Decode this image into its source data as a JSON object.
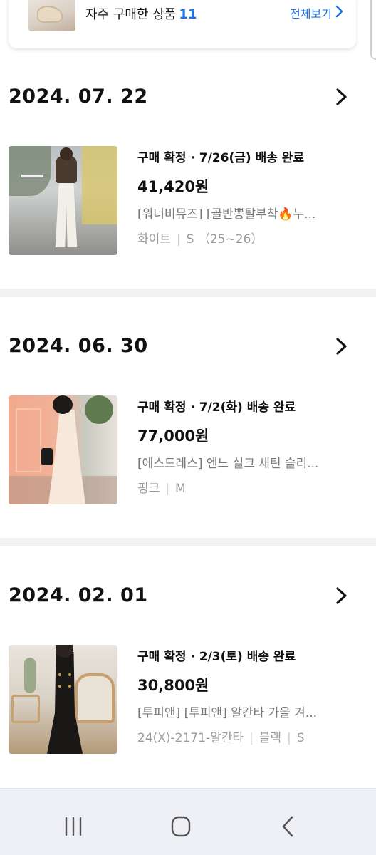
{
  "frequent": {
    "label": "자주 구매한 상품",
    "count": "11",
    "view_all": "전체보기"
  },
  "orders": [
    {
      "date": "2024. 07. 22",
      "status": "구매 확정 · 7/26(금) 배송 완료",
      "price": "41,420원",
      "name": "[워너비뮤즈] [골반뽕탈부착🔥누...",
      "options": [
        "화이트",
        "S （25~26）"
      ]
    },
    {
      "date": "2024. 06. 30",
      "status": "구매 확정 · 7/2(화) 배송 완료",
      "price": "77,000원",
      "name": "[에스드레스] 엔느 실크 새틴 슬리...",
      "options": [
        "핑크",
        "M"
      ]
    },
    {
      "date": "2024. 02. 01",
      "status": "구매 확정 · 2/3(토) 배송 완료",
      "price": "30,800원",
      "name": "[투피앤] [투피앤] 알칸타 가을 겨...",
      "options": [
        "24(X)-2171-알칸타",
        "블랙",
        "S"
      ]
    }
  ],
  "nav": {
    "icons": [
      "recent-apps-icon",
      "home-icon",
      "back-icon"
    ]
  },
  "colors": {
    "accent": "#1a73e8",
    "divider": "#f2f2f4",
    "navbar": "#eff0f5"
  }
}
